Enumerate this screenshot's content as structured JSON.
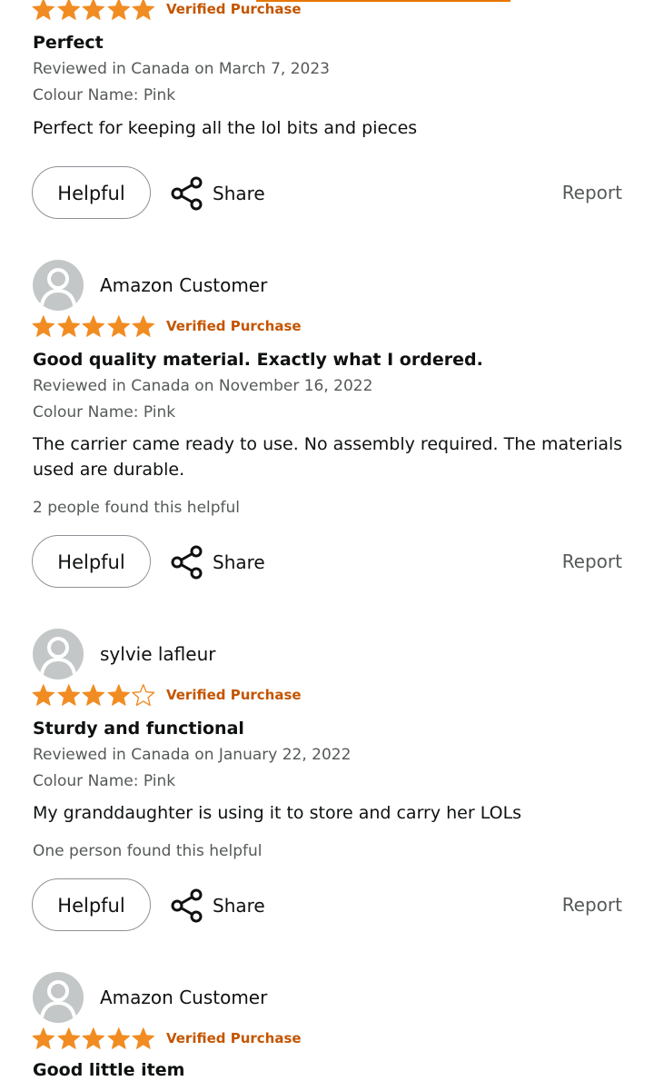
{
  "reviews": [
    {
      "reviewer": "",
      "rating": 5,
      "verified": "Verified Purchase",
      "title": "Perfect",
      "meta": "Reviewed in Canada on March 7, 2023",
      "colour": "Colour Name: Pink",
      "body": "Perfect for keeping all the lol bits and pieces",
      "helpful_count": "",
      "helpful_label": "Helpful",
      "share_label": "Share",
      "report_label": "Report"
    },
    {
      "reviewer": "Amazon Customer",
      "rating": 5,
      "verified": "Verified Purchase",
      "title": "Good quality material. Exactly what I ordered.",
      "meta": "Reviewed in Canada on November 16, 2022",
      "colour": "Colour Name: Pink",
      "body": "The carrier came ready to use. No assembly required. The materials used are durable.",
      "helpful_count": "2 people found this helpful",
      "helpful_label": "Helpful",
      "share_label": "Share",
      "report_label": "Report"
    },
    {
      "reviewer": "sylvie lafleur",
      "rating": 4,
      "verified": "Verified Purchase",
      "title": "Sturdy and functional",
      "meta": "Reviewed in Canada on January 22, 2022",
      "colour": "Colour Name: Pink",
      "body": "My granddaughter is using it to store and carry her LOLs",
      "helpful_count": "One person found this helpful",
      "helpful_label": "Helpful",
      "share_label": "Share",
      "report_label": "Report"
    },
    {
      "reviewer": "Amazon Customer",
      "rating": 5,
      "verified": "Verified Purchase",
      "title": "Good little item",
      "meta": "",
      "colour": "",
      "body": "",
      "helpful_count": "",
      "helpful_label": "",
      "share_label": "",
      "report_label": ""
    }
  ],
  "colors": {
    "star": "#f18c22",
    "verified": "#c45500",
    "muted": "#565959",
    "accent_line": "#e77600"
  },
  "icons": {
    "avatar": "user-silhouette-icon",
    "share": "share-nodes-icon",
    "star_full": "star-filled-icon",
    "star_empty": "star-outline-icon"
  }
}
